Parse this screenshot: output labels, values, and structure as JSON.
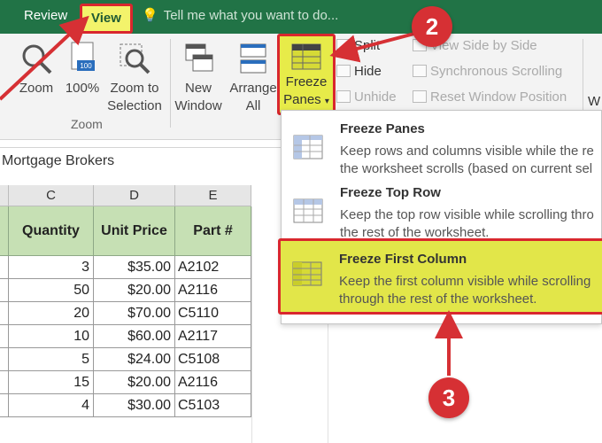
{
  "tabs": {
    "review": "Review",
    "view": "View"
  },
  "tell_me": "Tell me what you want to do...",
  "ribbon": {
    "zoom": "Zoom",
    "zoom100": "100%",
    "zoom_to_selection_1": "Zoom to",
    "zoom_to_selection_2": "Selection",
    "new_window_1": "New",
    "new_window_2": "Window",
    "arrange_all_1": "Arrange",
    "arrange_all_2": "All",
    "freeze_panes_1": "Freeze",
    "freeze_panes_2": "Panes",
    "split": "Split",
    "hide": "Hide",
    "unhide": "Unhide",
    "view_side_by_side": "View Side by Side",
    "synchronous_scrolling": "Synchronous Scrolling",
    "reset_window_position": "Reset Window Position",
    "zoom_group_label": "Zoom",
    "cut_off_label": "W"
  },
  "name_box": "Mortgage Brokers",
  "columns": [
    "C",
    "D",
    "E"
  ],
  "headers": [
    "Quantity",
    "Unit Price",
    "Part  #"
  ],
  "rows": [
    [
      "3",
      "$35.00",
      "A2102"
    ],
    [
      "50",
      "$20.00",
      "A2116"
    ],
    [
      "20",
      "$70.00",
      "C5110"
    ],
    [
      "10",
      "$60.00",
      "A2117"
    ],
    [
      "5",
      "$24.00",
      "C5108"
    ],
    [
      "15",
      "$20.00",
      "A2116"
    ],
    [
      "4",
      "$30.00",
      "C5103"
    ]
  ],
  "menu": [
    {
      "title": "Freeze Panes",
      "desc1": "Keep rows and columns visible while the re",
      "desc2": "the worksheet scrolls (based on current sel"
    },
    {
      "title": "Freeze Top Row",
      "desc1": "Keep the top row visible while scrolling thro",
      "desc2": "the rest of the worksheet."
    },
    {
      "title": "Freeze First Column",
      "desc1": "Keep the first column visible while scrolling",
      "desc2": "through the rest of the worksheet."
    }
  ],
  "callouts": [
    "2",
    "3"
  ],
  "colors": {
    "excel_green": "#217346",
    "highlight_yellow": "#e7eb49",
    "callout_red": "#d63034",
    "header_fill": "#c6e0b4"
  }
}
